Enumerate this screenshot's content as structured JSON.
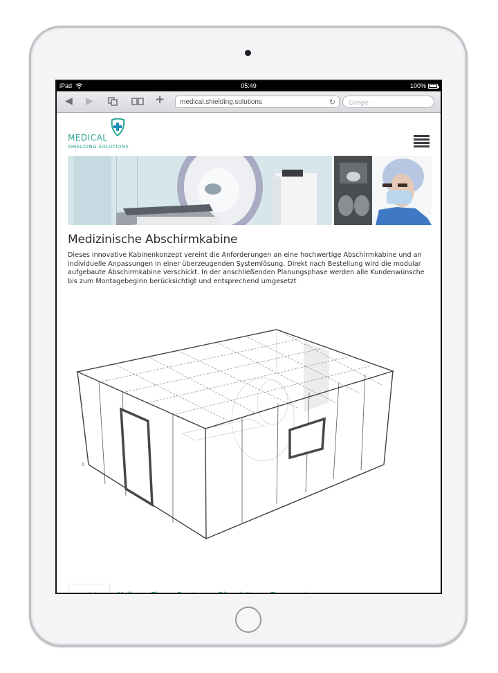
{
  "device": {
    "name": "iPad"
  },
  "status_bar": {
    "carrier": "iPad",
    "time": "05:49",
    "battery": "100%"
  },
  "browser": {
    "url": "medical.shielding.solutions",
    "search_placeholder": "Google",
    "icons": [
      "back-icon",
      "forward-icon",
      "tabs-icon",
      "bookmarks-icon",
      "add-icon",
      "reload-icon"
    ]
  },
  "site": {
    "logo": {
      "line1": "MEDICAL",
      "line2": "SHIELDING.SOLUTIONS"
    },
    "brand_color": "#2aa592",
    "menu_icon": "hamburger-icon"
  },
  "main": {
    "title": "Medizinische Abschirmkabine",
    "intro": "Dieses innovative Kabinenkonzept vereint die Anforderungen an eine hochwertige Abschirmkabine und an individuelle Anpassungen in einer überzeugenden Systemlösung. Direkt nach Bestellung wird die modular aufgebaute Abschirmkabine verschickt. In der anschließenden Planungsphase werden alle Kundenwünsche bis zum Montagebeginn berücksichtigt und entsprechend umgesetzt",
    "drawing": {
      "origin_label": "0"
    },
    "tabs": [
      {
        "label": "Ansicht",
        "active": true
      },
      {
        "label": "Maße",
        "active": false
      },
      {
        "label": "Tür",
        "active": false
      },
      {
        "label": "Fenster",
        "active": false
      },
      {
        "label": "Filterplatte",
        "active": false
      },
      {
        "label": "Tomograph",
        "active": false
      }
    ],
    "option_buttons_count": 7
  }
}
